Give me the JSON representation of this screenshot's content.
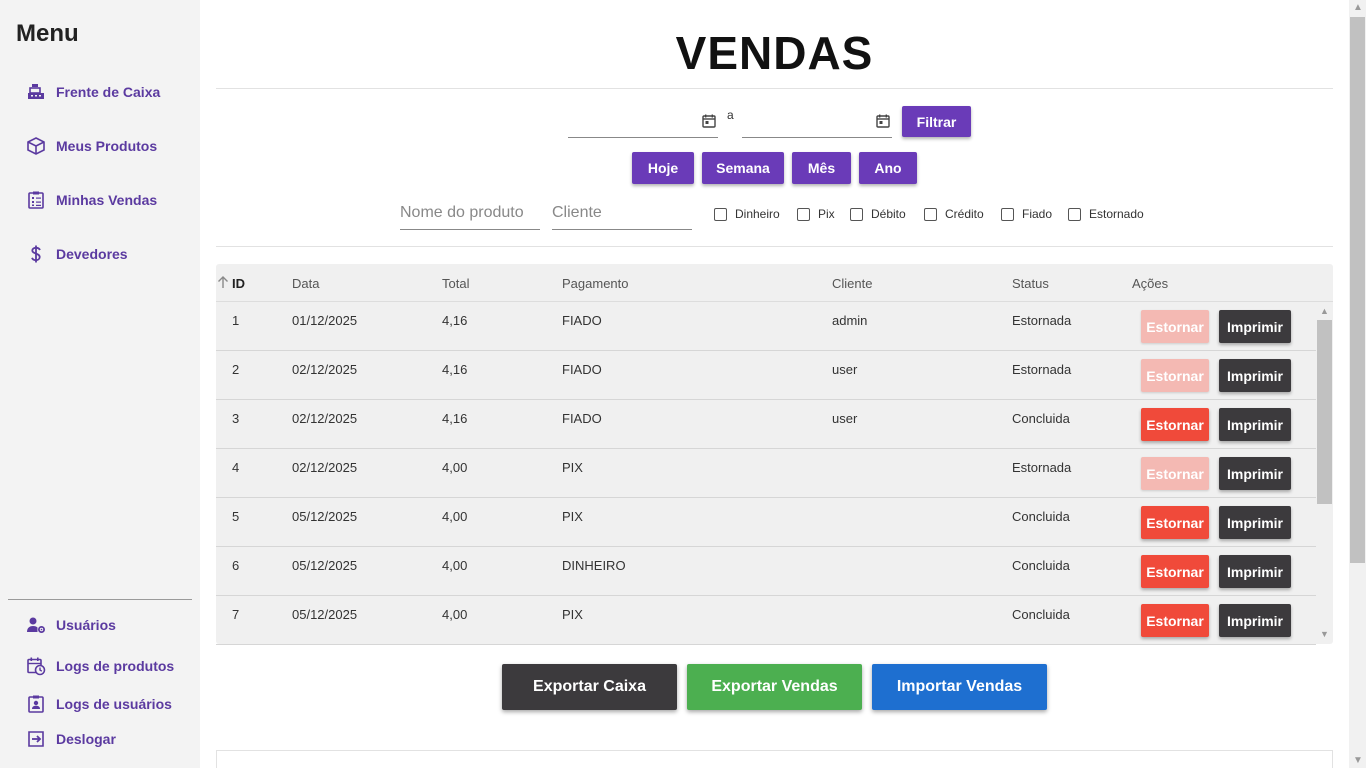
{
  "sidebar": {
    "title": "Menu",
    "top_items": [
      {
        "label": "Frente de Caixa",
        "icon": "cash-register-icon"
      },
      {
        "label": "Meus Produtos",
        "icon": "box-icon"
      },
      {
        "label": "Minhas Vendas",
        "icon": "clipboard-list-icon"
      },
      {
        "label": "Devedores",
        "icon": "dollar-icon"
      }
    ],
    "bottom_items": [
      {
        "label": "Usuários",
        "icon": "user-gear-icon"
      },
      {
        "label": "Logs de produtos",
        "icon": "calendar-clock-icon"
      },
      {
        "label": "Logs de usuários",
        "icon": "user-badge-icon"
      },
      {
        "label": "Deslogar",
        "icon": "logout-icon"
      }
    ]
  },
  "header": {
    "title": "VENDAS"
  },
  "filters": {
    "date_separator": "a",
    "filter_button": "Filtrar",
    "period_buttons": [
      "Hoje",
      "Semana",
      "Mês",
      "Ano"
    ],
    "product_placeholder": "Nome do produto",
    "client_placeholder": "Cliente",
    "payment_checkboxes": [
      "Dinheiro",
      "Pix",
      "Débito",
      "Crédito",
      "Fiado",
      "Estornado"
    ]
  },
  "table": {
    "columns": [
      "ID",
      "Data",
      "Total",
      "Pagamento",
      "Cliente",
      "Status",
      "Ações"
    ],
    "estornar_label": "Estornar",
    "imprimir_label": "Imprimir",
    "rows": [
      {
        "id": "1",
        "data": "01/12/2025",
        "total": "4,16",
        "pagamento": "FIADO",
        "cliente": "admin",
        "status": "Estornada",
        "estornar_enabled": false
      },
      {
        "id": "2",
        "data": "02/12/2025",
        "total": "4,16",
        "pagamento": "FIADO",
        "cliente": "user",
        "status": "Estornada",
        "estornar_enabled": false
      },
      {
        "id": "3",
        "data": "02/12/2025",
        "total": "4,16",
        "pagamento": "FIADO",
        "cliente": "user",
        "status": "Concluida",
        "estornar_enabled": true
      },
      {
        "id": "4",
        "data": "02/12/2025",
        "total": "4,00",
        "pagamento": "PIX",
        "cliente": "",
        "status": "Estornada",
        "estornar_enabled": false
      },
      {
        "id": "5",
        "data": "05/12/2025",
        "total": "4,00",
        "pagamento": "PIX",
        "cliente": "",
        "status": "Concluida",
        "estornar_enabled": true
      },
      {
        "id": "6",
        "data": "05/12/2025",
        "total": "4,00",
        "pagamento": "DINHEIRO",
        "cliente": "",
        "status": "Concluida",
        "estornar_enabled": true
      },
      {
        "id": "7",
        "data": "05/12/2025",
        "total": "4,00",
        "pagamento": "PIX",
        "cliente": "",
        "status": "Concluida",
        "estornar_enabled": true
      }
    ]
  },
  "actions": {
    "export_caixa": "Exportar Caixa",
    "export_vendas": "Exportar Vendas",
    "import_vendas": "Importar Vendas"
  },
  "colors": {
    "purple": "#6a3bb8",
    "red": "#f04a3a",
    "red_disabled": "#f4b9b3",
    "dark": "#3c3a3d",
    "green": "#4caf50",
    "blue": "#1e6fd0"
  }
}
